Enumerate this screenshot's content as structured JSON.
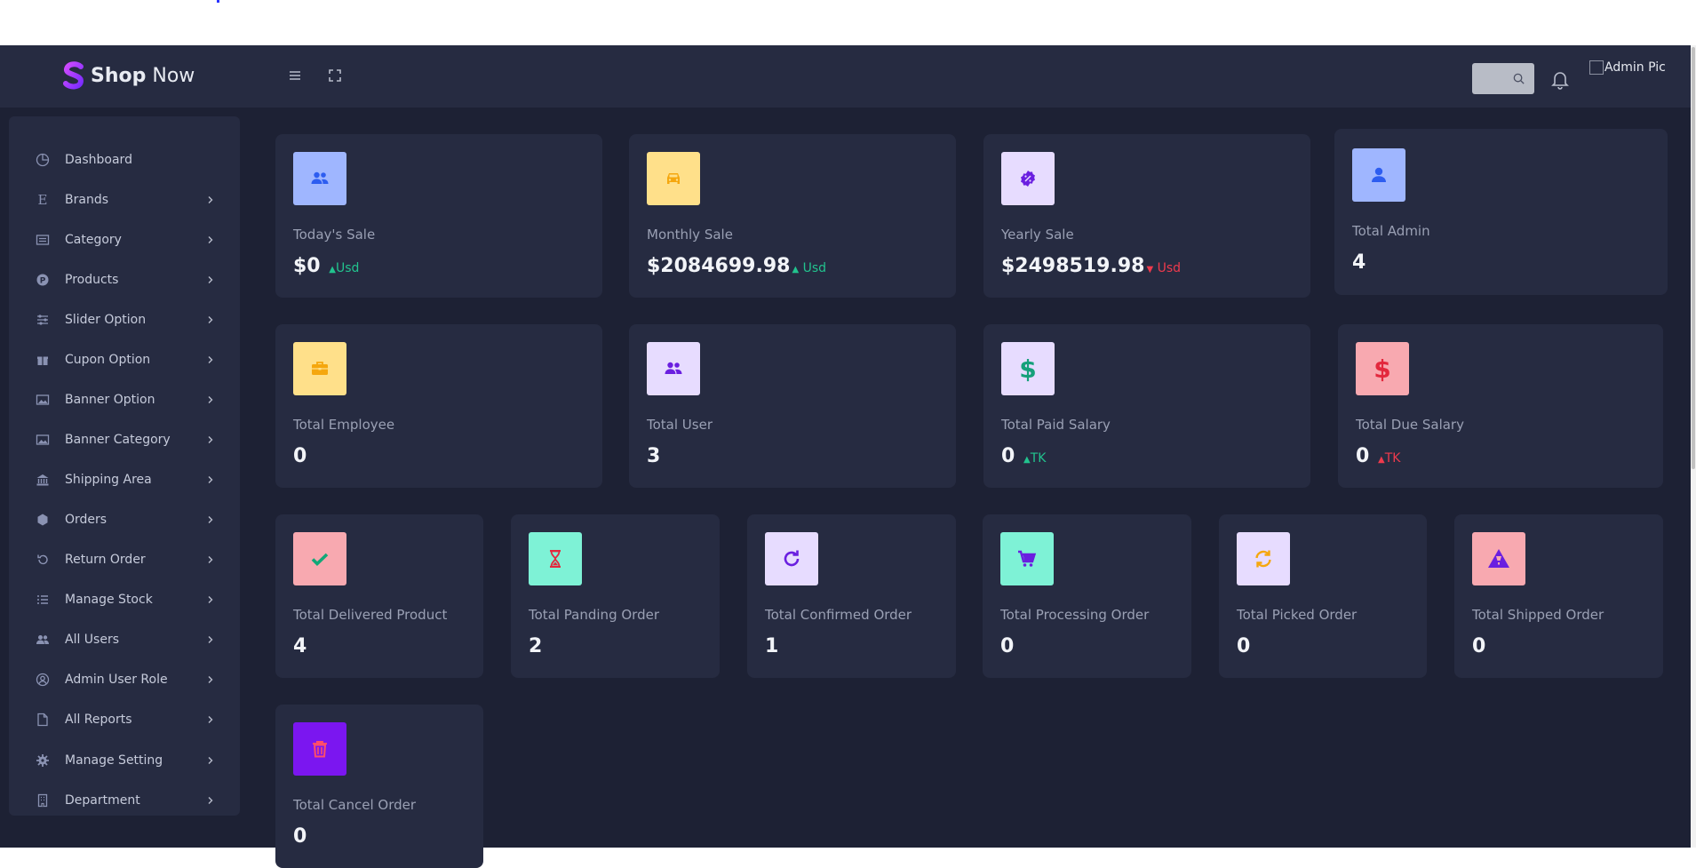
{
  "app": {
    "brand_bold": "Shop",
    "brand_rest": " Now",
    "admin_pic_alt": "Admin Pic"
  },
  "colors": {
    "bg": "#1d2134",
    "panel": "#262b41",
    "up": "#22c38e",
    "down": "#ee3a4d"
  },
  "sidebar": {
    "items": [
      {
        "label": "Dashboard",
        "icon": "chart-pie-icon",
        "has_chevron": false
      },
      {
        "label": "Brands",
        "icon": "letter-e-icon",
        "has_chevron": true
      },
      {
        "label": "Category",
        "icon": "list-card-icon",
        "has_chevron": true
      },
      {
        "label": "Products",
        "icon": "product-badge-icon",
        "has_chevron": true
      },
      {
        "label": "Slider Option",
        "icon": "sliders-icon",
        "has_chevron": true
      },
      {
        "label": "Cupon Option",
        "icon": "gift-icon",
        "has_chevron": true
      },
      {
        "label": "Banner Option",
        "icon": "image-icon",
        "has_chevron": true
      },
      {
        "label": "Banner Category",
        "icon": "image-icon",
        "has_chevron": true
      },
      {
        "label": "Shipping Area",
        "icon": "bank-icon",
        "has_chevron": true
      },
      {
        "label": "Orders",
        "icon": "hexagon-icon",
        "has_chevron": true
      },
      {
        "label": "Return Order",
        "icon": "undo-icon",
        "has_chevron": true
      },
      {
        "label": "Manage Stock",
        "icon": "list-icon",
        "has_chevron": true
      },
      {
        "label": "All Users",
        "icon": "users-icon",
        "has_chevron": true
      },
      {
        "label": "Admin User Role",
        "icon": "user-circle-icon",
        "has_chevron": true
      },
      {
        "label": "All Reports",
        "icon": "file-icon",
        "has_chevron": true
      },
      {
        "label": "Manage Setting",
        "icon": "gear-icon",
        "has_chevron": true
      },
      {
        "label": "Department",
        "icon": "building-icon",
        "has_chevron": true
      }
    ]
  },
  "stats": {
    "todays_sale": {
      "label": "Today's Sale",
      "value": "$0",
      "unit": "Usd",
      "trend": "up",
      "icon": "users-icon"
    },
    "monthly_sale": {
      "label": "Monthly Sale",
      "value": "$2084699.98",
      "unit": "Usd",
      "trend": "up",
      "icon": "car-icon"
    },
    "yearly_sale": {
      "label": "Yearly Sale",
      "value": "$2498519.98",
      "unit": "Usd",
      "trend": "down",
      "icon": "discount-badge-icon"
    },
    "total_admin": {
      "label": "Total Admin",
      "value": "4",
      "icon": "user-icon"
    },
    "total_employee": {
      "label": "Total Employee",
      "value": "0",
      "icon": "briefcase-icon"
    },
    "total_user": {
      "label": "Total User",
      "value": "3",
      "icon": "users-icon"
    },
    "total_paid_salary": {
      "label": "Total Paid Salary",
      "value": "0",
      "unit": "TK",
      "trend": "up",
      "icon": "dollar-icon"
    },
    "total_due_salary": {
      "label": "Total Due Salary",
      "value": "0",
      "unit": "TK",
      "trend": "up",
      "icon": "dollar-icon"
    },
    "total_delivered_product": {
      "label": "Total Delivered Product",
      "value": "4",
      "icon": "check-icon"
    },
    "total_panding_order": {
      "label": "Total Panding Order",
      "value": "2",
      "icon": "hourglass-icon"
    },
    "total_confirmed_order": {
      "label": "Total Confirmed Order",
      "value": "1",
      "icon": "refresh-icon"
    },
    "total_processing_order": {
      "label": "Total Processing Order",
      "value": "0",
      "icon": "cart-icon"
    },
    "total_picked_order": {
      "label": "Total Picked Order",
      "value": "0",
      "icon": "sync-icon"
    },
    "total_shipped_order": {
      "label": "Total Shipped Order",
      "value": "0",
      "icon": "warning-icon"
    },
    "total_cancel_order": {
      "label": "Total Cancel Order",
      "value": "0",
      "icon": "trash-icon"
    }
  }
}
